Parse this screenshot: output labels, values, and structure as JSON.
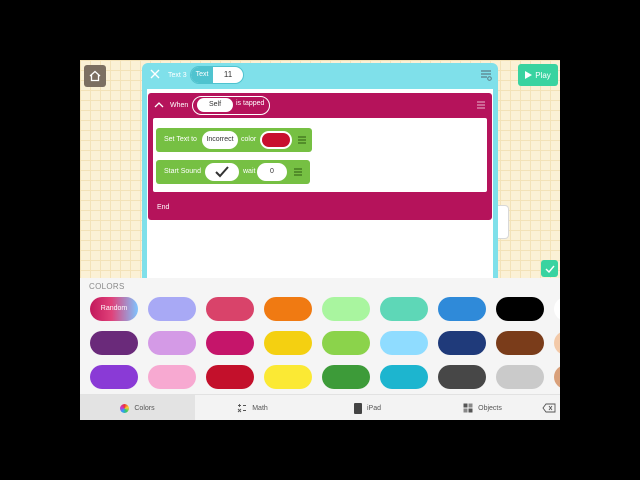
{
  "header": {
    "object_label": "Text 3",
    "property_label": "Text",
    "property_value": "11"
  },
  "top_bar": {
    "play_label": "Play"
  },
  "rule": {
    "when_label": "When",
    "subject": "Self",
    "event_label": "is tapped",
    "end_label": "End",
    "actions": [
      {
        "label": "Set Text to",
        "text_value": "Incorrect",
        "color_label": "color",
        "color_value": "#c8102e"
      },
      {
        "label": "Start Sound",
        "wait_label": "wait",
        "wait_value": "0"
      }
    ]
  },
  "palette": {
    "title": "COLORS",
    "random_label": "Random",
    "rows": [
      [
        "#a8a9f5",
        "#d9436a",
        "#f07a12",
        "#a9f59f",
        "#5ed7b7",
        "#2f8ad9",
        "#000000",
        "#ffffff"
      ],
      [
        "#6a2a7a",
        "#d49ae6",
        "#c5156a",
        "#f4d011",
        "#8bd34b",
        "#8fdcff",
        "#1f3a7a",
        "#7a3c1a",
        "#f3c9a8"
      ],
      [
        "#8a3ad6",
        "#f7a9d1",
        "#c3102b",
        "#fbe934",
        "#3d9b39",
        "#1db5cf",
        "#474747",
        "#cacaca",
        "#d9a07a"
      ]
    ],
    "accent": "#39d3a0",
    "rule_color": "#b5135b",
    "action_color": "#76c043"
  },
  "tabs": [
    {
      "label": "Colors",
      "icon": "colors-icon"
    },
    {
      "label": "Math",
      "icon": "math-icon"
    },
    {
      "label": "iPad",
      "icon": "ipad-icon"
    },
    {
      "label": "Objects",
      "icon": "objects-icon"
    }
  ]
}
